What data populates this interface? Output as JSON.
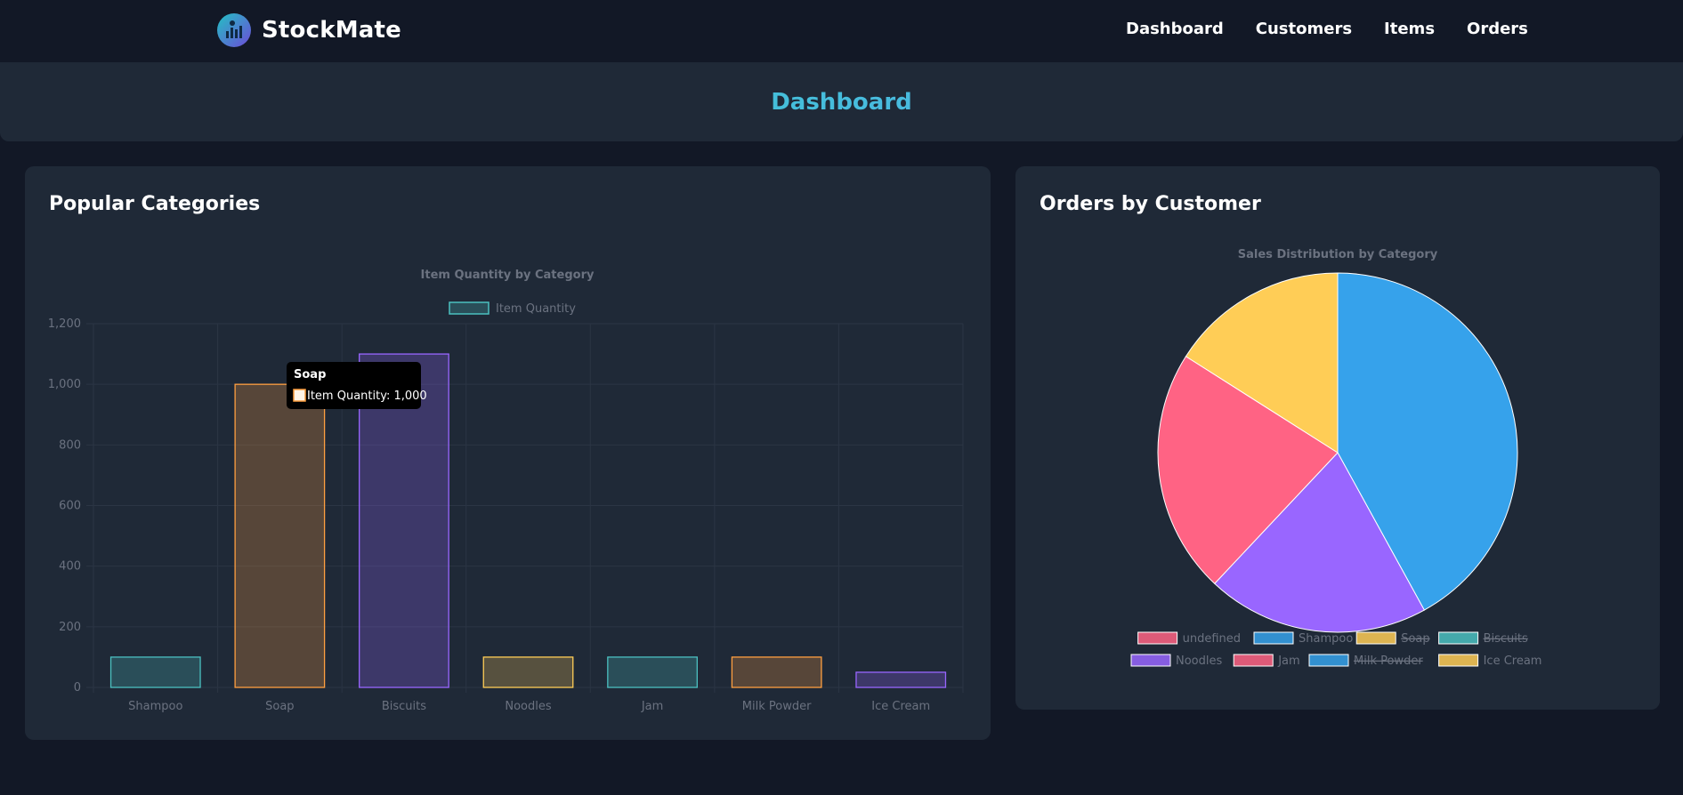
{
  "brand": {
    "name": "StockMate",
    "logo_icon": "chart-logo-icon"
  },
  "nav": {
    "items": [
      "Dashboard",
      "Customers",
      "Items",
      "Orders"
    ]
  },
  "page_title": "Dashboard",
  "cards": {
    "left_title": "Popular Categories",
    "right_title": "Orders by Customer"
  },
  "tooltip": {
    "title": "Soap",
    "body": "Item Quantity: 1,000"
  },
  "colors": {
    "background": "#121826",
    "card": "#1f2937",
    "teal": "#4bc0c0",
    "orange": "#ff9f40",
    "purple": "#9966ff",
    "yellow": "#ffcd56",
    "blue": "#36a2eb",
    "pink": "#ff6384"
  },
  "chart_data": [
    {
      "type": "bar",
      "title": "Item Quantity by Category",
      "categories": [
        "Shampoo",
        "Soap",
        "Biscuits",
        "Noodles",
        "Jam",
        "Milk Powder",
        "Ice Cream"
      ],
      "series": [
        {
          "name": "Item Quantity",
          "values": [
            100,
            1000,
            1100,
            100,
            100,
            100,
            50
          ]
        }
      ],
      "bar_colors": [
        "#4bc0c0",
        "#ff9f40",
        "#9966ff",
        "#ffcd56",
        "#4bc0c0",
        "#ff9f40",
        "#9966ff"
      ],
      "yticks": [
        "0",
        "200",
        "400",
        "600",
        "800",
        "1,000",
        "1,200"
      ],
      "ylim": [
        0,
        1200
      ],
      "grid": true,
      "legend": "top"
    },
    {
      "type": "pie",
      "title": "Sales Distribution by Category",
      "slices": [
        {
          "label": "Shampoo",
          "value": 42,
          "color": "#36a2eb"
        },
        {
          "label": "Noodles",
          "value": 20,
          "color": "#9966ff"
        },
        {
          "label": "Jam",
          "value": 22,
          "color": "#ff6384"
        },
        {
          "label": "Ice Cream",
          "value": 16,
          "color": "#ffcd56"
        }
      ],
      "legend": [
        {
          "label": "undefined",
          "color": "#ff6384",
          "hidden": false
        },
        {
          "label": "Shampoo",
          "color": "#36a2eb",
          "hidden": false
        },
        {
          "label": "Soap",
          "color": "#ffcd56",
          "hidden": true
        },
        {
          "label": "Biscuits",
          "color": "#4bc0c0",
          "hidden": true
        },
        {
          "label": "Noodles",
          "color": "#9966ff",
          "hidden": false
        },
        {
          "label": "Jam",
          "color": "#ff6384",
          "hidden": false
        },
        {
          "label": "Milk Powder",
          "color": "#36a2eb",
          "hidden": true
        },
        {
          "label": "Ice Cream",
          "color": "#ffcd56",
          "hidden": false
        }
      ],
      "legend_position": "bottom"
    }
  ]
}
